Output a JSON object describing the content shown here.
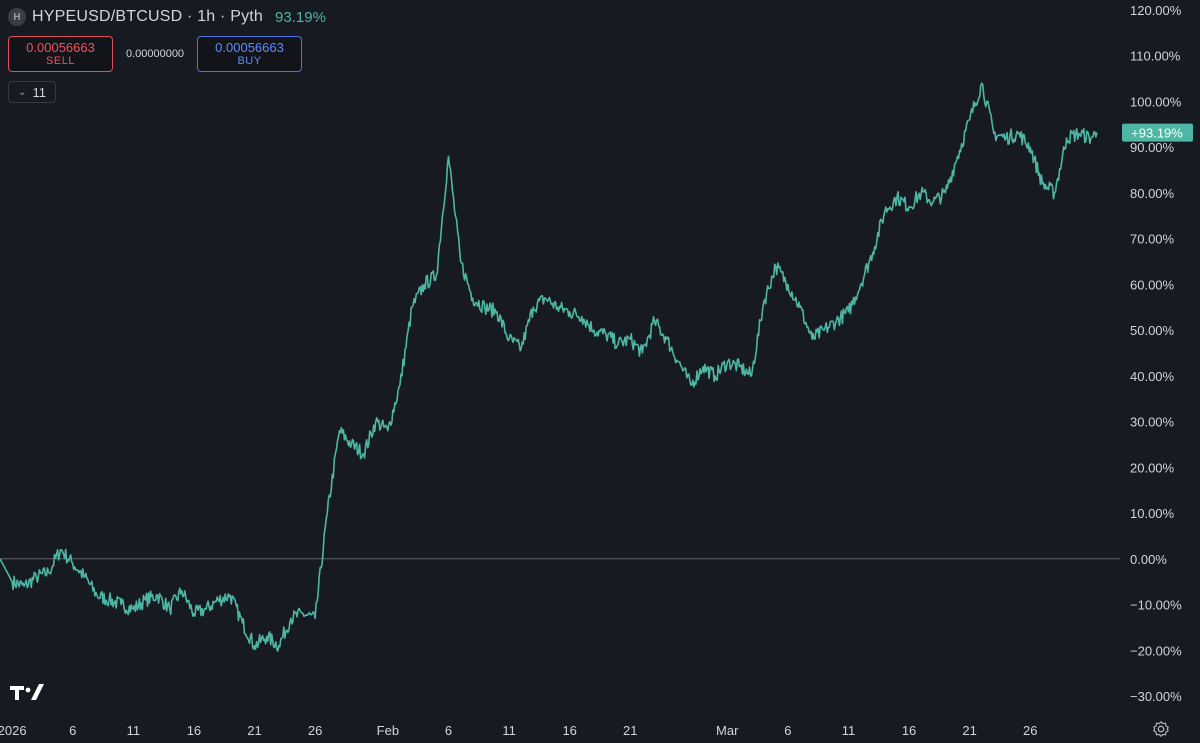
{
  "header": {
    "symbol_icon": "H",
    "title": "HYPEUSD/BTCUSD · 1h · Pyth",
    "change": "93.19%"
  },
  "trade": {
    "sell_price": "0.00056663",
    "sell_label": "SELL",
    "spread": "0.00000000",
    "buy_price": "0.00056663",
    "buy_label": "BUY"
  },
  "indicators_toggle": {
    "count": "11",
    "icon": "chevron-down-icon"
  },
  "colors": {
    "background": "#181a21",
    "line": "#4db6a4",
    "sell": "#f0525c",
    "buy": "#5b8cff",
    "axis_text": "#d1d4dc"
  },
  "chart_data": {
    "type": "line",
    "series": [
      {
        "values_pct": [
          [
            0,
            0
          ],
          [
            1,
            -5
          ],
          [
            2,
            -6
          ],
          [
            3,
            -4
          ],
          [
            4,
            -3
          ],
          [
            5,
            2
          ],
          [
            6,
            -1
          ],
          [
            7,
            -4
          ],
          [
            8,
            -8
          ],
          [
            9,
            -9
          ],
          [
            10,
            -10
          ],
          [
            11,
            -11
          ],
          [
            12,
            -9
          ],
          [
            13,
            -8
          ],
          [
            14,
            -11
          ],
          [
            15,
            -7
          ],
          [
            16,
            -12
          ],
          [
            17,
            -11
          ],
          [
            18,
            -9
          ],
          [
            19,
            -8
          ],
          [
            20,
            -14
          ],
          [
            21,
            -19
          ],
          [
            22,
            -17
          ],
          [
            23,
            -19
          ],
          [
            24,
            -13
          ],
          [
            25,
            -12
          ],
          [
            26,
            -13
          ],
          [
            27,
            10
          ],
          [
            28,
            28
          ],
          [
            29,
            25
          ],
          [
            30,
            23
          ],
          [
            31,
            30
          ],
          [
            32,
            28
          ],
          [
            33,
            38
          ],
          [
            34,
            55
          ],
          [
            35,
            60
          ],
          [
            36,
            62
          ],
          [
            37,
            88
          ],
          [
            38,
            65
          ],
          [
            39,
            57
          ],
          [
            40,
            55
          ],
          [
            41,
            54
          ],
          [
            42,
            48
          ],
          [
            43,
            46
          ],
          [
            44,
            55
          ],
          [
            45,
            57
          ],
          [
            46,
            55
          ],
          [
            47,
            54
          ],
          [
            48,
            53
          ],
          [
            49,
            50
          ],
          [
            50,
            49
          ],
          [
            51,
            47
          ],
          [
            52,
            48
          ],
          [
            53,
            45
          ],
          [
            54,
            52
          ],
          [
            55,
            48
          ],
          [
            56,
            43
          ],
          [
            57,
            38
          ],
          [
            58,
            42
          ],
          [
            59,
            40
          ],
          [
            60,
            43
          ],
          [
            61,
            42
          ],
          [
            62,
            40
          ],
          [
            63,
            56
          ],
          [
            64,
            64
          ],
          [
            65,
            60
          ],
          [
            66,
            55
          ],
          [
            67,
            48
          ],
          [
            68,
            50
          ],
          [
            69,
            52
          ],
          [
            70,
            54
          ],
          [
            71,
            60
          ],
          [
            72,
            67
          ],
          [
            73,
            76
          ],
          [
            74,
            79
          ],
          [
            75,
            77
          ],
          [
            76,
            80
          ],
          [
            77,
            78
          ],
          [
            78,
            80
          ],
          [
            79,
            88
          ],
          [
            80,
            96
          ],
          [
            81,
            104
          ],
          [
            82,
            93
          ],
          [
            83,
            92
          ],
          [
            84,
            93
          ],
          [
            85,
            90
          ],
          [
            86,
            82
          ],
          [
            87,
            80
          ],
          [
            88,
            92
          ],
          [
            89,
            93
          ],
          [
            90,
            92
          ],
          [
            90.5,
            93.19
          ]
        ],
        "last_value_label": "+93.19%"
      }
    ],
    "y_ticks": [
      "120.00%",
      "110.00%",
      "100.00%",
      "90.00%",
      "80.00%",
      "70.00%",
      "60.00%",
      "50.00%",
      "40.00%",
      "30.00%",
      "20.00%",
      "10.00%",
      "0.00%",
      "−10.00%",
      "−20.00%",
      "−30.00%"
    ],
    "y_tick_values": [
      120,
      110,
      100,
      90,
      80,
      70,
      60,
      50,
      40,
      30,
      20,
      10,
      0,
      -10,
      -20,
      -30
    ],
    "x_ticks": [
      {
        "label": "2026",
        "day": 1
      },
      {
        "label": "6",
        "day": 6
      },
      {
        "label": "11",
        "day": 11
      },
      {
        "label": "16",
        "day": 16
      },
      {
        "label": "21",
        "day": 21
      },
      {
        "label": "26",
        "day": 26
      },
      {
        "label": "Feb",
        "day": 32
      },
      {
        "label": "6",
        "day": 37
      },
      {
        "label": "11",
        "day": 42
      },
      {
        "label": "16",
        "day": 47
      },
      {
        "label": "21",
        "day": 52
      },
      {
        "label": "Mar",
        "day": 60
      },
      {
        "label": "6",
        "day": 65
      },
      {
        "label": "11",
        "day": 70
      },
      {
        "label": "16",
        "day": 75
      },
      {
        "label": "21",
        "day": 80
      },
      {
        "label": "26",
        "day": 85
      }
    ],
    "ylim": [
      -30,
      120
    ],
    "baseline": 0
  }
}
